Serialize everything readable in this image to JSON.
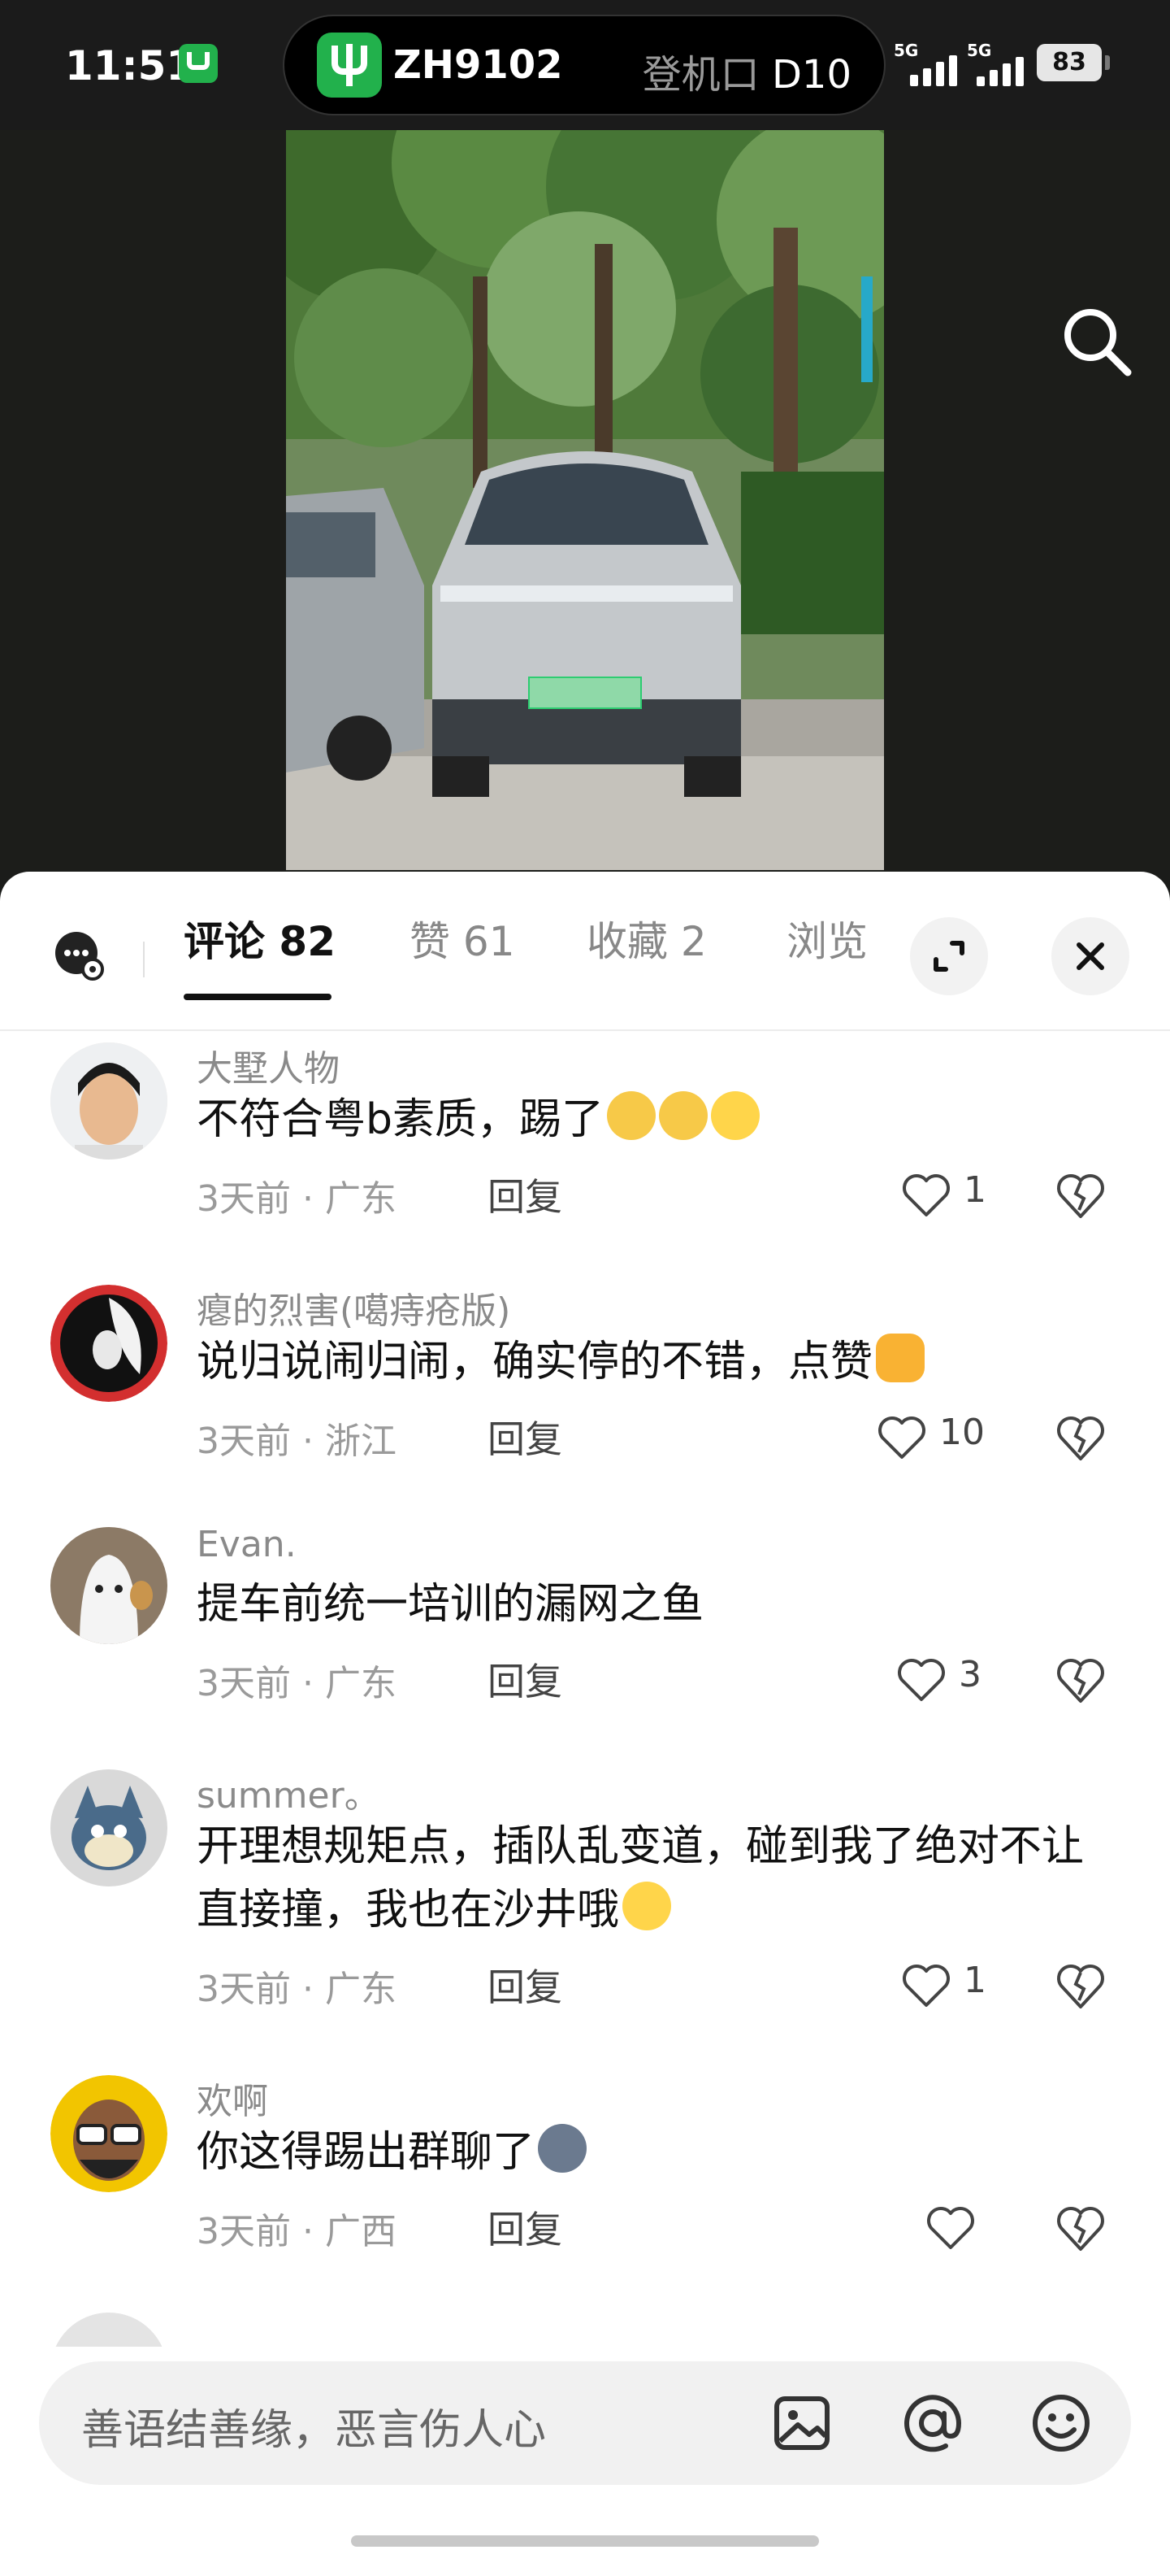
{
  "status_bar": {
    "time": "11:51",
    "flight_number": "ZH9102",
    "gate_label": "登机口",
    "gate": "D10",
    "signal_1": "5G",
    "signal_2": "5G",
    "battery": "83",
    "app_icon": "airline-app-icon"
  },
  "photo": {
    "description_icon": "car-photo",
    "search_icon": "search-icon"
  },
  "tabs": [
    {
      "label": "评论 82",
      "active": true
    },
    {
      "label": "赞 61"
    },
    {
      "label": "收藏 2"
    },
    {
      "label": "浏览"
    }
  ],
  "comments": [
    {
      "user": "大墅人物",
      "text": "不符合粤b素质，踢了",
      "emojis": [
        "dog",
        "dog",
        "think"
      ],
      "time": "3天前",
      "location": "广东",
      "reply": "回复",
      "likes": "1"
    },
    {
      "user": "瘪的烈害(噶痔疮版)",
      "text": "说归说闹归闹，确实停的不错，点赞",
      "emojis": [
        "thumb"
      ],
      "time": "3天前",
      "location": "浙江",
      "reply": "回复",
      "likes": "10"
    },
    {
      "user": "Evan.",
      "text": "提车前统一培训的漏网之鱼",
      "emojis": [],
      "time": "3天前",
      "location": "广东",
      "reply": "回复",
      "likes": "3"
    },
    {
      "user": "summer。",
      "text": "开理想规矩点，插队乱变道，碰到我了绝对不让直接撞，我也在沙井哦",
      "emojis": [
        "grin"
      ],
      "time": "3天前",
      "location": "广东",
      "reply": "回复",
      "likes": "1"
    },
    {
      "user": "欢啊",
      "text": "你这得踢出群聊了",
      "emojis": [
        "husky"
      ],
      "time": "3天前",
      "location": "广西",
      "reply": "回复",
      "likes": ""
    }
  ],
  "separator": "·",
  "input": {
    "placeholder": "善语结善缘，恶言伤人心"
  }
}
